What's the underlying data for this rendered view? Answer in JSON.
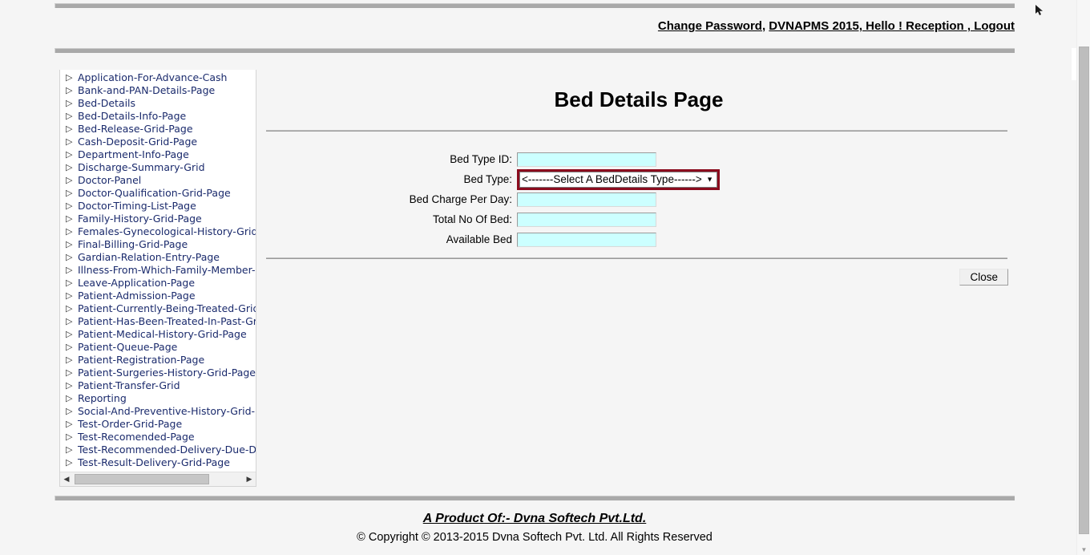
{
  "topnav": {
    "links": [
      {
        "label": "Change Password",
        "name": "change-password-link"
      },
      {
        "label": "DVNAPMS 2015, Hello ! Reception , Logout",
        "name": "account-logout-link"
      }
    ],
    "separator": ", "
  },
  "sidebar": {
    "items": [
      {
        "label": "Application-For-Advance-Cash"
      },
      {
        "label": "Bank-and-PAN-Details-Page"
      },
      {
        "label": "Bed-Details"
      },
      {
        "label": "Bed-Details-Info-Page"
      },
      {
        "label": "Bed-Release-Grid-Page"
      },
      {
        "label": "Cash-Deposit-Grid-Page"
      },
      {
        "label": "Department-Info-Page"
      },
      {
        "label": "Discharge-Summary-Grid"
      },
      {
        "label": "Doctor-Panel"
      },
      {
        "label": "Doctor-Qualification-Grid-Page"
      },
      {
        "label": "Doctor-Timing-List-Page"
      },
      {
        "label": "Family-History-Grid-Page"
      },
      {
        "label": "Females-Gynecological-History-Grid-Page"
      },
      {
        "label": "Final-Billing-Grid-Page"
      },
      {
        "label": "Gardian-Relation-Entry-Page"
      },
      {
        "label": "Illness-From-Which-Family-Member-Grid-Page"
      },
      {
        "label": "Leave-Application-Page"
      },
      {
        "label": "Patient-Admission-Page"
      },
      {
        "label": "Patient-Currently-Being-Treated-Grid-Page"
      },
      {
        "label": "Patient-Has-Been-Treated-In-Past-Grid-Page"
      },
      {
        "label": "Patient-Medical-History-Grid-Page"
      },
      {
        "label": "Patient-Queue-Page"
      },
      {
        "label": "Patient-Registration-Page"
      },
      {
        "label": "Patient-Surgeries-History-Grid-Page"
      },
      {
        "label": "Patient-Transfer-Grid"
      },
      {
        "label": "Reporting"
      },
      {
        "label": "Social-And-Preventive-History-Grid-Page"
      },
      {
        "label": "Test-Order-Grid-Page"
      },
      {
        "label": "Test-Recomended-Page"
      },
      {
        "label": "Test-Recommended-Delivery-Due-Date-Page"
      },
      {
        "label": "Test-Result-Delivery-Grid-Page"
      }
    ],
    "expand_arrow": "▷",
    "scroll_left_arrow": "◀",
    "scroll_right_arrow": "▶"
  },
  "main": {
    "title": "Bed Details Page",
    "fields": [
      {
        "label": "Bed Type ID:",
        "value": "",
        "name": "bed-type-id-input"
      },
      {
        "label": "Bed Charge Per Day:",
        "value": "",
        "name": "bed-charge-per-day-input"
      },
      {
        "label": "Total No Of Bed:",
        "value": "",
        "name": "total-no-of-bed-input"
      },
      {
        "label": "Available Bed",
        "value": "",
        "name": "available-bed-input"
      }
    ],
    "bed_type": {
      "label": "Bed Type:",
      "selected": "<-------Select A BedDetails Type------>",
      "options": [
        "<-------Select A BedDetails Type------>"
      ],
      "caret": "▼",
      "highlight_color": "#8B0C1E"
    },
    "close_button": "Close"
  },
  "footer": {
    "product": "A Product Of:- Dvna Softech Pvt.Ltd.",
    "copyright": "© Copyright © 2013-2015 Dvna Softech Pvt. Ltd. All Rights Reserved"
  },
  "scrollbar": {
    "down_arrow": "▼"
  },
  "colors": {
    "field_bg": "#CCFFFF",
    "link": "#1A2A6C",
    "rule": "#A9A9A9"
  }
}
